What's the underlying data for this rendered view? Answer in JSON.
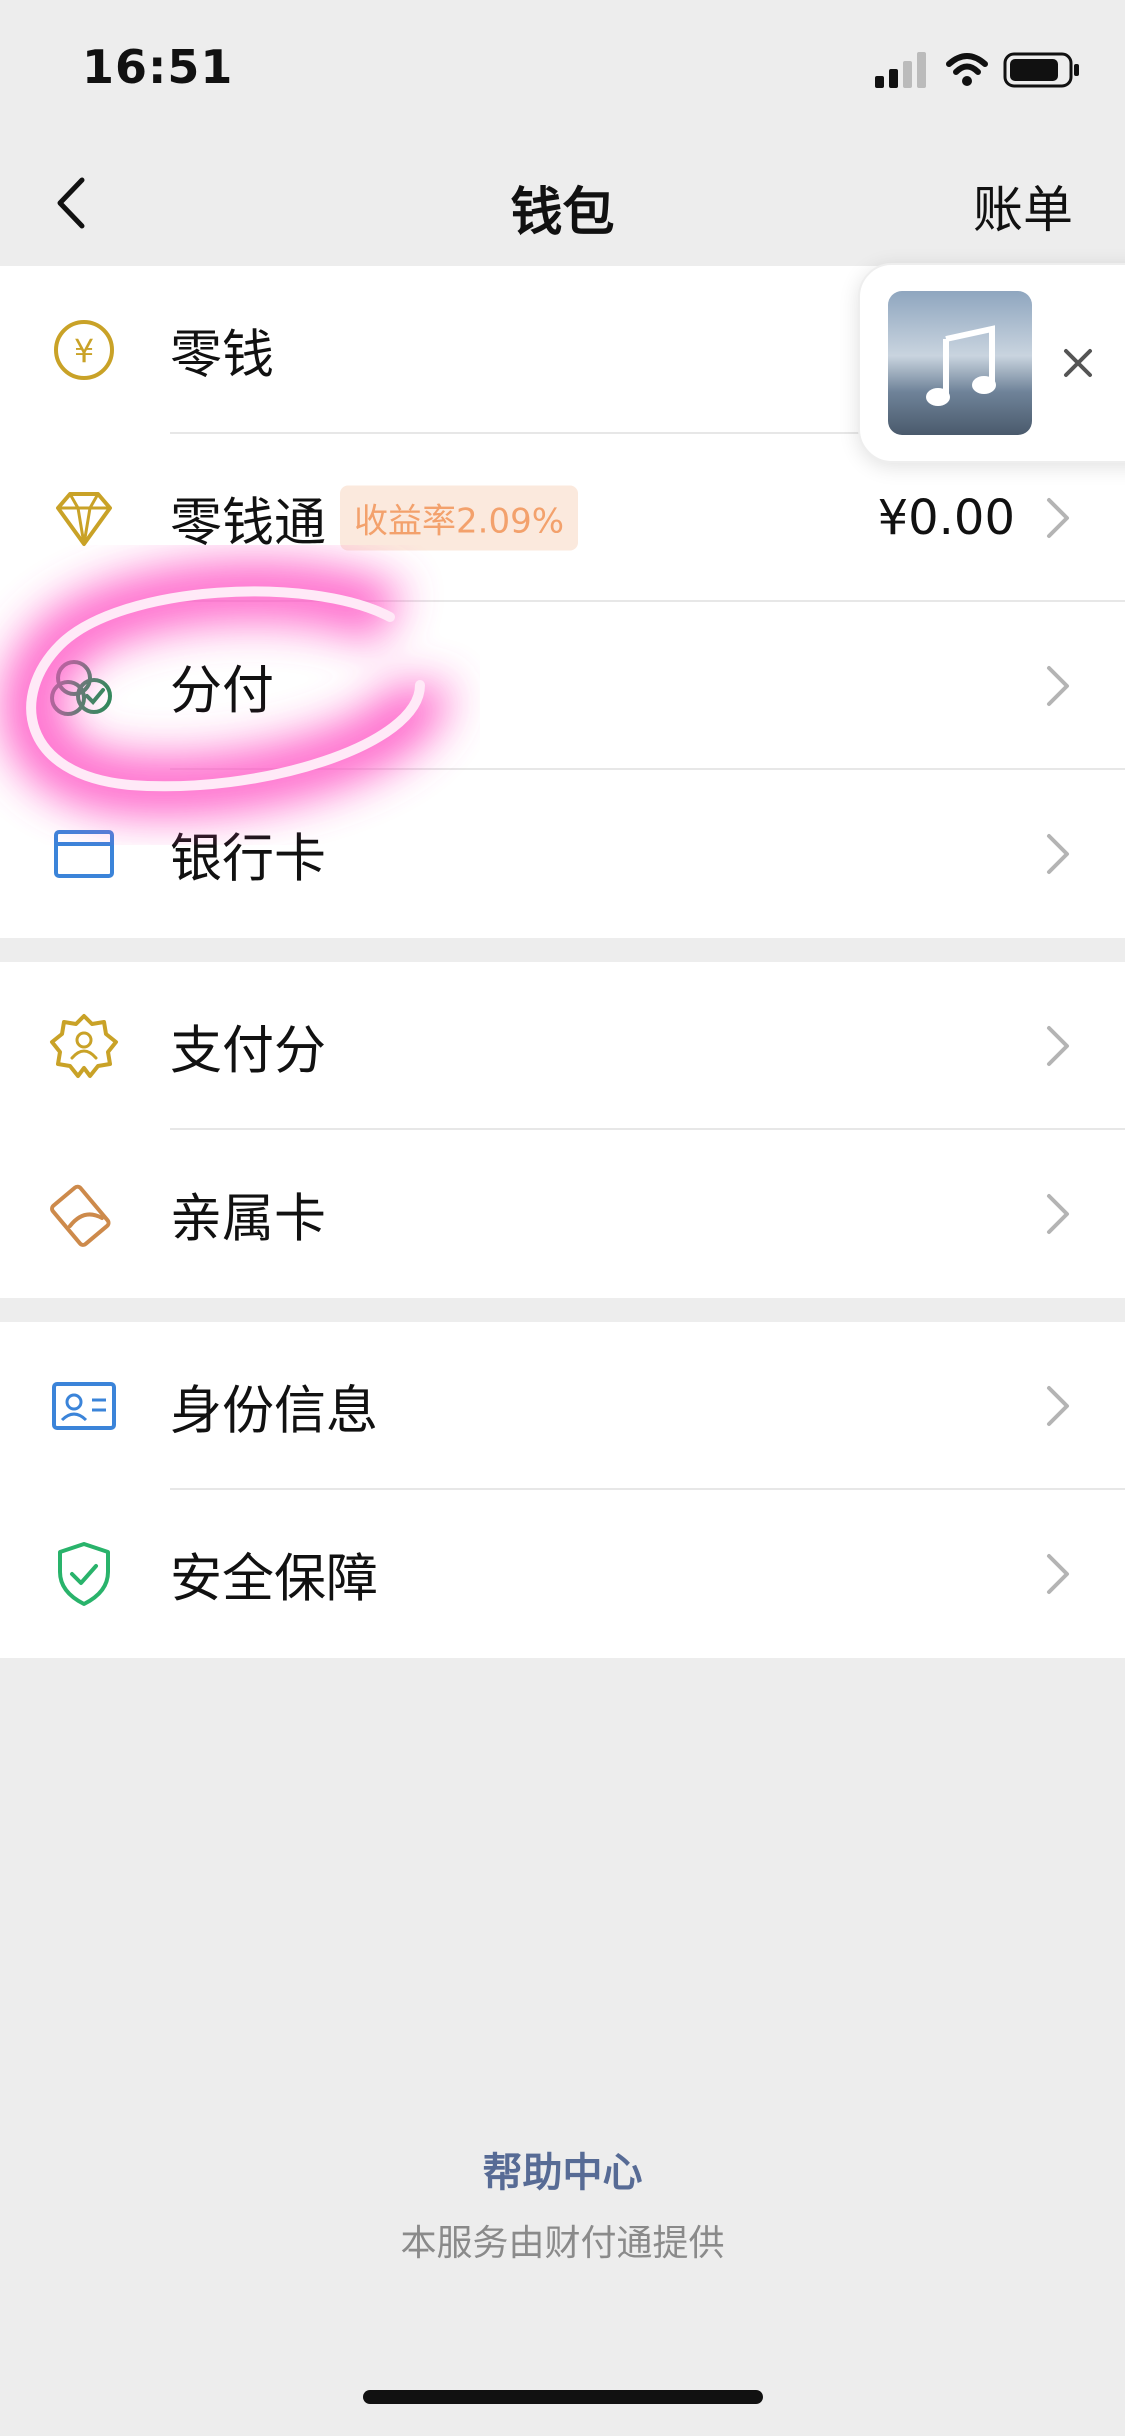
{
  "status": {
    "time": "16:51"
  },
  "nav": {
    "title": "钱包",
    "right": "账单"
  },
  "groups": [
    {
      "items": [
        {
          "label": "零钱",
          "icon": "yuan-coin-icon"
        },
        {
          "label": "零钱通",
          "badge": "收益率2.09%",
          "value": "¥0.00",
          "icon": "diamond-icon"
        },
        {
          "label": "分付",
          "icon": "fenfu-icon"
        },
        {
          "label": "银行卡",
          "icon": "bank-card-icon"
        }
      ]
    },
    {
      "items": [
        {
          "label": "支付分",
          "icon": "badge-user-icon"
        },
        {
          "label": "亲属卡",
          "icon": "family-card-icon"
        }
      ]
    },
    {
      "items": [
        {
          "label": "身份信息",
          "icon": "id-card-icon"
        },
        {
          "label": "安全保障",
          "icon": "shield-check-icon"
        }
      ]
    }
  ],
  "footer": {
    "link": "帮助中心",
    "note": "本服务由财付通提供"
  },
  "colors": {
    "gold": "#c9a227",
    "blue": "#3b84d9",
    "green": "#29b36b",
    "highlight": "#ff4fc3",
    "link": "#576b95"
  }
}
